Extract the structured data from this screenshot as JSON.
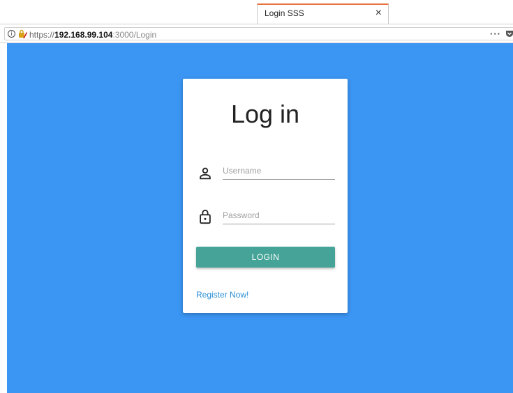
{
  "browser": {
    "tab": {
      "title": "Login SSS",
      "close_glyph": "×"
    },
    "url": {
      "scheme": "https://",
      "host": "192.168.99.104",
      "rest": ":3000/Login"
    },
    "more_glyph": "···"
  },
  "page": {
    "background_color": "#3b95f2",
    "title": "Log in",
    "username": {
      "placeholder": "Username",
      "icon": "person-icon"
    },
    "password": {
      "placeholder": "Password",
      "icon": "lock-icon"
    },
    "login_label": "LOGIN",
    "login_color": "#45a497",
    "register_label": "Register Now!"
  }
}
